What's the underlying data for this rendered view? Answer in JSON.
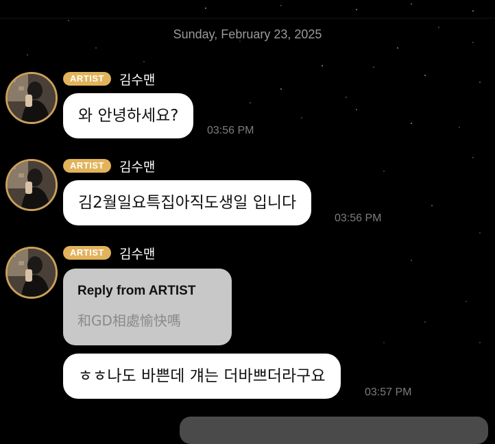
{
  "date_divider": "Sunday, February 23, 2025",
  "messages": [
    {
      "badge": "ARTIST",
      "sender": "김수맨",
      "text": "와 안녕하세요?",
      "time": "03:56 PM"
    },
    {
      "badge": "ARTIST",
      "sender": "김수맨",
      "text": "김2월일요특집아직도생일 입니다",
      "time": "03:56 PM"
    },
    {
      "badge": "ARTIST",
      "sender": "김수맨",
      "reply": {
        "title": "Reply from ARTIST",
        "text": "和GD相處愉快嗎"
      },
      "text": "ㅎㅎ나도 바쁜데 걔는 더바쁘더라구요",
      "time": "03:57 PM"
    }
  ],
  "colors": {
    "background": "#000000",
    "badge": "#e2b35b",
    "avatar_ring": "#c9a15a",
    "bubble": "#ffffff",
    "reply_card": "#c8c8c8",
    "timestamp": "#7d7d7d"
  },
  "icons": [
    "avatar"
  ]
}
